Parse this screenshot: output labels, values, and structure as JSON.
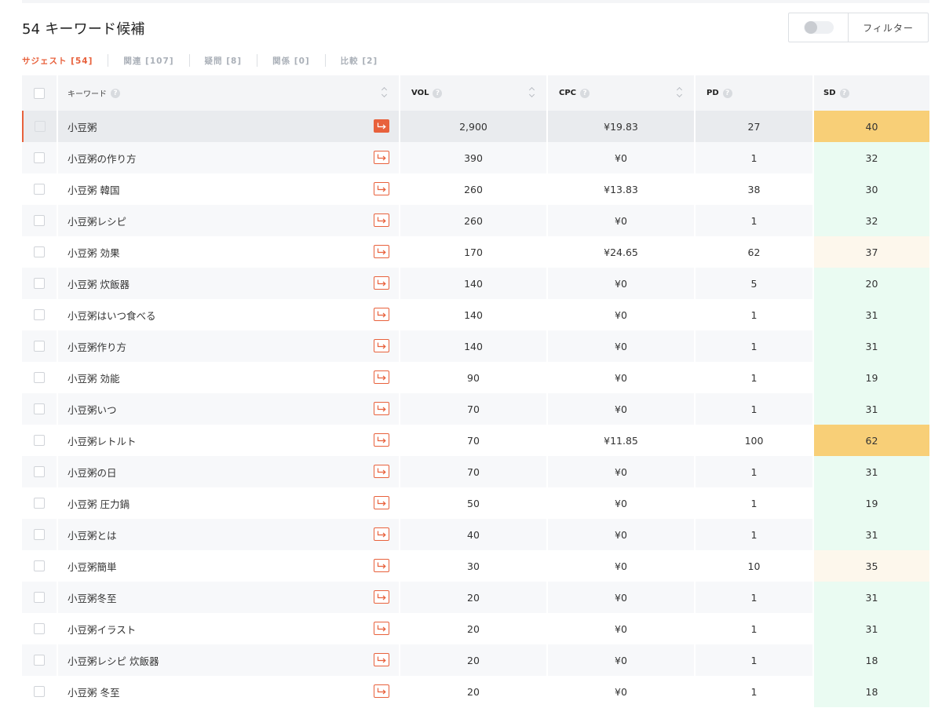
{
  "header": {
    "title": "54 キーワード候補",
    "filter_label": "フィルター"
  },
  "tabs": [
    {
      "label": "サジェスト [54]",
      "active": true
    },
    {
      "label": "関連 [107]",
      "active": false
    },
    {
      "label": "疑問 [8]",
      "active": false
    },
    {
      "label": "関係 [0]",
      "active": false
    },
    {
      "label": "比較 [2]",
      "active": false
    }
  ],
  "table": {
    "columns": {
      "keyword": "キーワード",
      "vol": "VOL",
      "cpc": "CPC",
      "pd": "PD",
      "sd": "SD"
    },
    "rows": [
      {
        "keyword": "小豆粥",
        "vol": "2,900",
        "cpc": "¥19.83",
        "pd": "27",
        "sd": "40"
      },
      {
        "keyword": "小豆粥の作り方",
        "vol": "390",
        "cpc": "¥0",
        "pd": "1",
        "sd": "32"
      },
      {
        "keyword": "小豆粥 韓国",
        "vol": "260",
        "cpc": "¥13.83",
        "pd": "38",
        "sd": "30"
      },
      {
        "keyword": "小豆粥レシピ",
        "vol": "260",
        "cpc": "¥0",
        "pd": "1",
        "sd": "32"
      },
      {
        "keyword": "小豆粥 効果",
        "vol": "170",
        "cpc": "¥24.65",
        "pd": "62",
        "sd": "37"
      },
      {
        "keyword": "小豆粥 炊飯器",
        "vol": "140",
        "cpc": "¥0",
        "pd": "5",
        "sd": "20"
      },
      {
        "keyword": "小豆粥はいつ食べる",
        "vol": "140",
        "cpc": "¥0",
        "pd": "1",
        "sd": "31"
      },
      {
        "keyword": "小豆粥作り方",
        "vol": "140",
        "cpc": "¥0",
        "pd": "1",
        "sd": "31"
      },
      {
        "keyword": "小豆粥 効能",
        "vol": "90",
        "cpc": "¥0",
        "pd": "1",
        "sd": "19"
      },
      {
        "keyword": "小豆粥いつ",
        "vol": "70",
        "cpc": "¥0",
        "pd": "1",
        "sd": "31"
      },
      {
        "keyword": "小豆粥レトルト",
        "vol": "70",
        "cpc": "¥11.85",
        "pd": "100",
        "sd": "62"
      },
      {
        "keyword": "小豆粥の日",
        "vol": "70",
        "cpc": "¥0",
        "pd": "1",
        "sd": "31"
      },
      {
        "keyword": "小豆粥 圧力鍋",
        "vol": "50",
        "cpc": "¥0",
        "pd": "1",
        "sd": "19"
      },
      {
        "keyword": "小豆粥とは",
        "vol": "40",
        "cpc": "¥0",
        "pd": "1",
        "sd": "31"
      },
      {
        "keyword": "小豆粥簡単",
        "vol": "30",
        "cpc": "¥0",
        "pd": "10",
        "sd": "35"
      },
      {
        "keyword": "小豆粥冬至",
        "vol": "20",
        "cpc": "¥0",
        "pd": "1",
        "sd": "31"
      },
      {
        "keyword": "小豆粥イラスト",
        "vol": "20",
        "cpc": "¥0",
        "pd": "1",
        "sd": "31"
      },
      {
        "keyword": "小豆粥レシピ 炊飯器",
        "vol": "20",
        "cpc": "¥0",
        "pd": "1",
        "sd": "18"
      },
      {
        "keyword": "小豆粥 冬至",
        "vol": "20",
        "cpc": "¥0",
        "pd": "1",
        "sd": "18"
      }
    ]
  },
  "colors": {
    "accent": "#e8613c",
    "sd_high": "#f8cf77",
    "sd_mid": "#fdf7ec",
    "sd_low": "#eafbf2"
  }
}
